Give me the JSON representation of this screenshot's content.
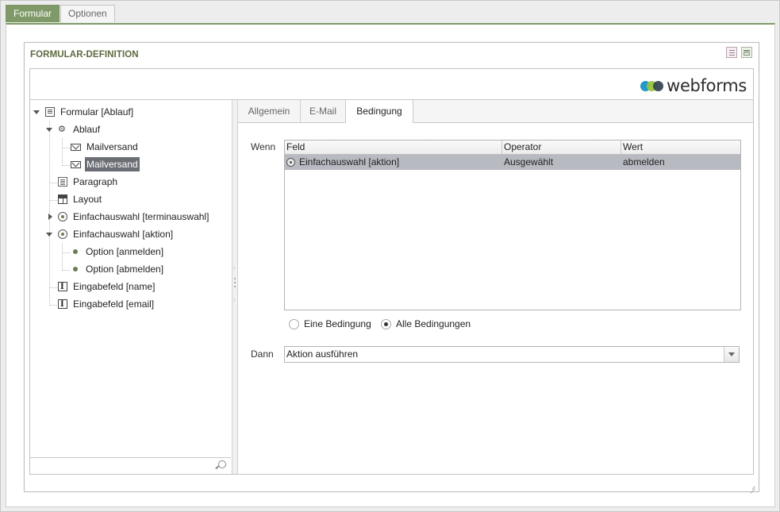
{
  "top_tabs": [
    {
      "label": "Formular",
      "active": true
    },
    {
      "label": "Optionen",
      "active": false
    }
  ],
  "panel": {
    "title": "FORMULAR-DEFINITION",
    "header_icons": [
      "document-icon",
      "maximize-icon"
    ]
  },
  "brand": {
    "logo_text": "webforms",
    "logo_colors": [
      "#1f9ac9",
      "#9bc53d",
      "#2d3e50"
    ]
  },
  "tree": {
    "items": [
      {
        "label": "Formular [Ablauf]",
        "icon": "form-icon",
        "expanded": true,
        "selected": false
      },
      {
        "label": "Ablauf",
        "icon": "gears-icon",
        "expanded": true,
        "selected": false
      },
      {
        "label": "Mailversand",
        "icon": "mail-icon",
        "selected": false
      },
      {
        "label": "Mailversand",
        "icon": "mail-icon",
        "selected": true
      },
      {
        "label": "Paragraph",
        "icon": "paragraph-icon",
        "selected": false
      },
      {
        "label": "Layout",
        "icon": "layout-icon",
        "selected": false
      },
      {
        "label": "Einfachauswahl [terminauswahl]",
        "icon": "radio-icon",
        "expanded": false,
        "selected": false
      },
      {
        "label": "Einfachauswahl [aktion]",
        "icon": "radio-icon",
        "expanded": true,
        "selected": false
      },
      {
        "label": "Option [anmelden]",
        "icon": "bullet-icon",
        "selected": false
      },
      {
        "label": "Option [abmelden]",
        "icon": "bullet-icon",
        "selected": false
      },
      {
        "label": "Eingabefeld [name]",
        "icon": "input-field-icon",
        "selected": false
      },
      {
        "label": "Eingabefeld [email]",
        "icon": "input-field-icon",
        "selected": false
      }
    ],
    "search_value": "",
    "search_placeholder": ""
  },
  "right_tabs": [
    {
      "label": "Allgemein",
      "active": false
    },
    {
      "label": "E-Mail",
      "active": false
    },
    {
      "label": "Bedingung",
      "active": true
    }
  ],
  "condition": {
    "wenn_label": "Wenn",
    "columns": [
      "Feld",
      "Operator",
      "Wert"
    ],
    "rows": [
      {
        "feld": "Einfachauswahl [aktion]",
        "operator": "Ausgewählt",
        "wert": "abmelden",
        "selected": true
      }
    ],
    "match_options": [
      {
        "label": "Eine Bedingung",
        "checked": false
      },
      {
        "label": "Alle Bedingungen",
        "checked": true
      }
    ],
    "dann_label": "Dann",
    "dann_value": "Aktion ausführen"
  }
}
